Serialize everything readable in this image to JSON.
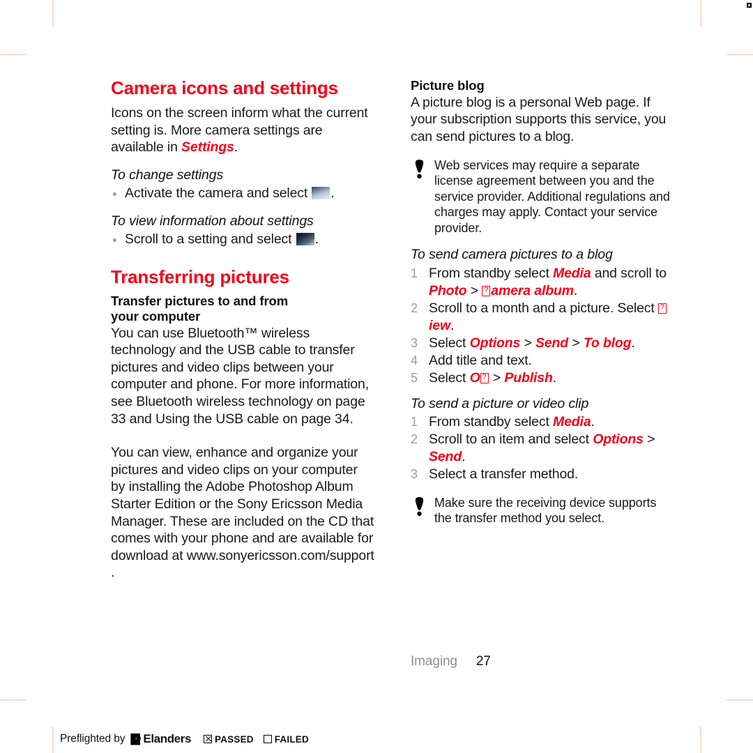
{
  "document": {
    "chapter": "Imaging",
    "page_number": "27"
  },
  "left_column": {
    "heading1": "Camera icons and settings",
    "intro_part1": "Icons on the screen inform what the current setting is. More camera settings are available in ",
    "intro_emphasis": "Settings",
    "intro_end": ".",
    "proc1_title": "To change settings",
    "proc1_step": "Activate the camera and select",
    "proc1_step_end": ".",
    "proc2_title": "To view information about settings",
    "proc2_step": "Scroll to a setting and select",
    "proc2_step_end": ".",
    "heading2": "Transferring pictures",
    "sub_heading_line1": "Transfer pictures to and from",
    "sub_heading_line2": "your computer",
    "para1": "You can use Bluetooth™ wireless technology and the USB cable to transfer pictures and video clips between your computer and phone. For more information, see Bluetooth wireless technology on page 33 and Using the USB cable on page 34.",
    "para2": "You can view, enhance and organize your pictures and video clips on your computer by installing the Adobe Photoshop  Album Starter Edition or the Sony Ericsson Media Manager. These are included on the CD that comes with your phone and are available for download at www.sonyericsson.com/support ."
  },
  "right_column": {
    "sub_heading": "Picture blog",
    "para1": "A picture blog is a personal Web page. If your subscription supports this service, you can send pictures to a blog.",
    "note1": "Web services may require a separate license agreement between you and the service provider. Additional regulations and charges may apply. Contact your service provider.",
    "proc1_title": "To send camera pictures to a blog",
    "proc1_steps": [
      {
        "num": "1",
        "parts": [
          {
            "type": "text",
            "value": "From standby select "
          },
          {
            "type": "em",
            "value": "Media"
          },
          {
            "type": "text",
            "value": " and scroll to "
          },
          {
            "type": "em",
            "value": "Photo"
          },
          {
            "type": "gt",
            "value": " > "
          },
          {
            "type": "tofu",
            "value": "C"
          },
          {
            "type": "em",
            "value": "amera album"
          },
          {
            "type": "text",
            "value": "."
          }
        ]
      },
      {
        "num": "2",
        "parts": [
          {
            "type": "text",
            "value": "Scroll to a month and a picture. Select "
          },
          {
            "type": "tofu",
            "value": "V"
          },
          {
            "type": "em",
            "value": "iew"
          },
          {
            "type": "text",
            "value": "."
          }
        ]
      },
      {
        "num": "3",
        "parts": [
          {
            "type": "text",
            "value": "Select "
          },
          {
            "type": "em",
            "value": "Options"
          },
          {
            "type": "gt",
            "value": " > "
          },
          {
            "type": "em",
            "value": "Send"
          },
          {
            "type": "gt",
            "value": " > "
          },
          {
            "type": "em",
            "value": "To blog"
          },
          {
            "type": "text",
            "value": "."
          }
        ]
      },
      {
        "num": "4",
        "parts": [
          {
            "type": "text",
            "value": "Add title and text."
          }
        ]
      },
      {
        "num": "5",
        "parts": [
          {
            "type": "text",
            "value": "Select "
          },
          {
            "type": "em",
            "value": "O"
          },
          {
            "type": "tofu",
            "value": "K"
          },
          {
            "type": "gt",
            "value": " > "
          },
          {
            "type": "em",
            "value": "Publish"
          },
          {
            "type": "text",
            "value": "."
          }
        ]
      }
    ],
    "proc2_title": "To send a picture or video clip",
    "proc2_steps": [
      {
        "num": "1",
        "parts": [
          {
            "type": "text",
            "value": "From standby select "
          },
          {
            "type": "em",
            "value": "Media"
          },
          {
            "type": "text",
            "value": "."
          }
        ]
      },
      {
        "num": "2",
        "parts": [
          {
            "type": "text",
            "value": "Scroll to an item and select "
          },
          {
            "type": "em",
            "value": "Options"
          },
          {
            "type": "gt",
            "value": " > "
          },
          {
            "type": "em",
            "value": "Send"
          },
          {
            "type": "text",
            "value": "."
          }
        ]
      },
      {
        "num": "3",
        "parts": [
          {
            "type": "text",
            "value": "Select a transfer method."
          }
        ]
      }
    ],
    "note2": "Make sure the receiving device supports the transfer method you select."
  },
  "preflight": {
    "label": "Preflighted by",
    "brand": "Elanders",
    "passed_label": "PASSED",
    "failed_label": "FAILED",
    "passed_checked": true,
    "failed_checked": false
  },
  "colors": {
    "accent_red": "#f30019",
    "crop_mark": "#fbdccd",
    "muted_gray": "#8f8f8f",
    "bullet_gray": "#9c9c9c"
  }
}
